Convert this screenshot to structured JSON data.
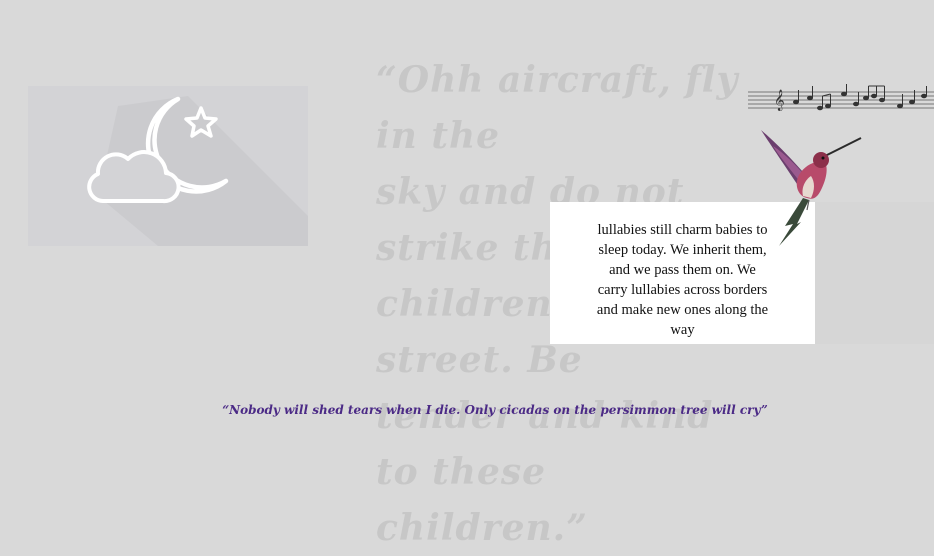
{
  "script_quote": {
    "lines": [
      "“Ohh aircraft, fly in the",
      "sky and do not strike the",
      "children in the street. Be",
      "tender and kind to these",
      "children.”"
    ]
  },
  "card": {
    "lines": [
      "lullabies still charm babies to",
      "sleep today. We inherit them,",
      "and we pass them on. We",
      "carry lullabies across borders",
      "and make new ones along the",
      "way"
    ]
  },
  "bottom_quote": {
    "text": "“Nobody will shed tears when I die. Only cicadas on the persimmon tree will cry”"
  },
  "icons": {
    "moon": "moon-star-cloud-icon",
    "music": "music-notes-icon",
    "bird": "hummingbird-icon"
  },
  "colors": {
    "background": "#d9d9d9",
    "card": "#ffffff",
    "bottom_quote": "#4b2a86"
  }
}
